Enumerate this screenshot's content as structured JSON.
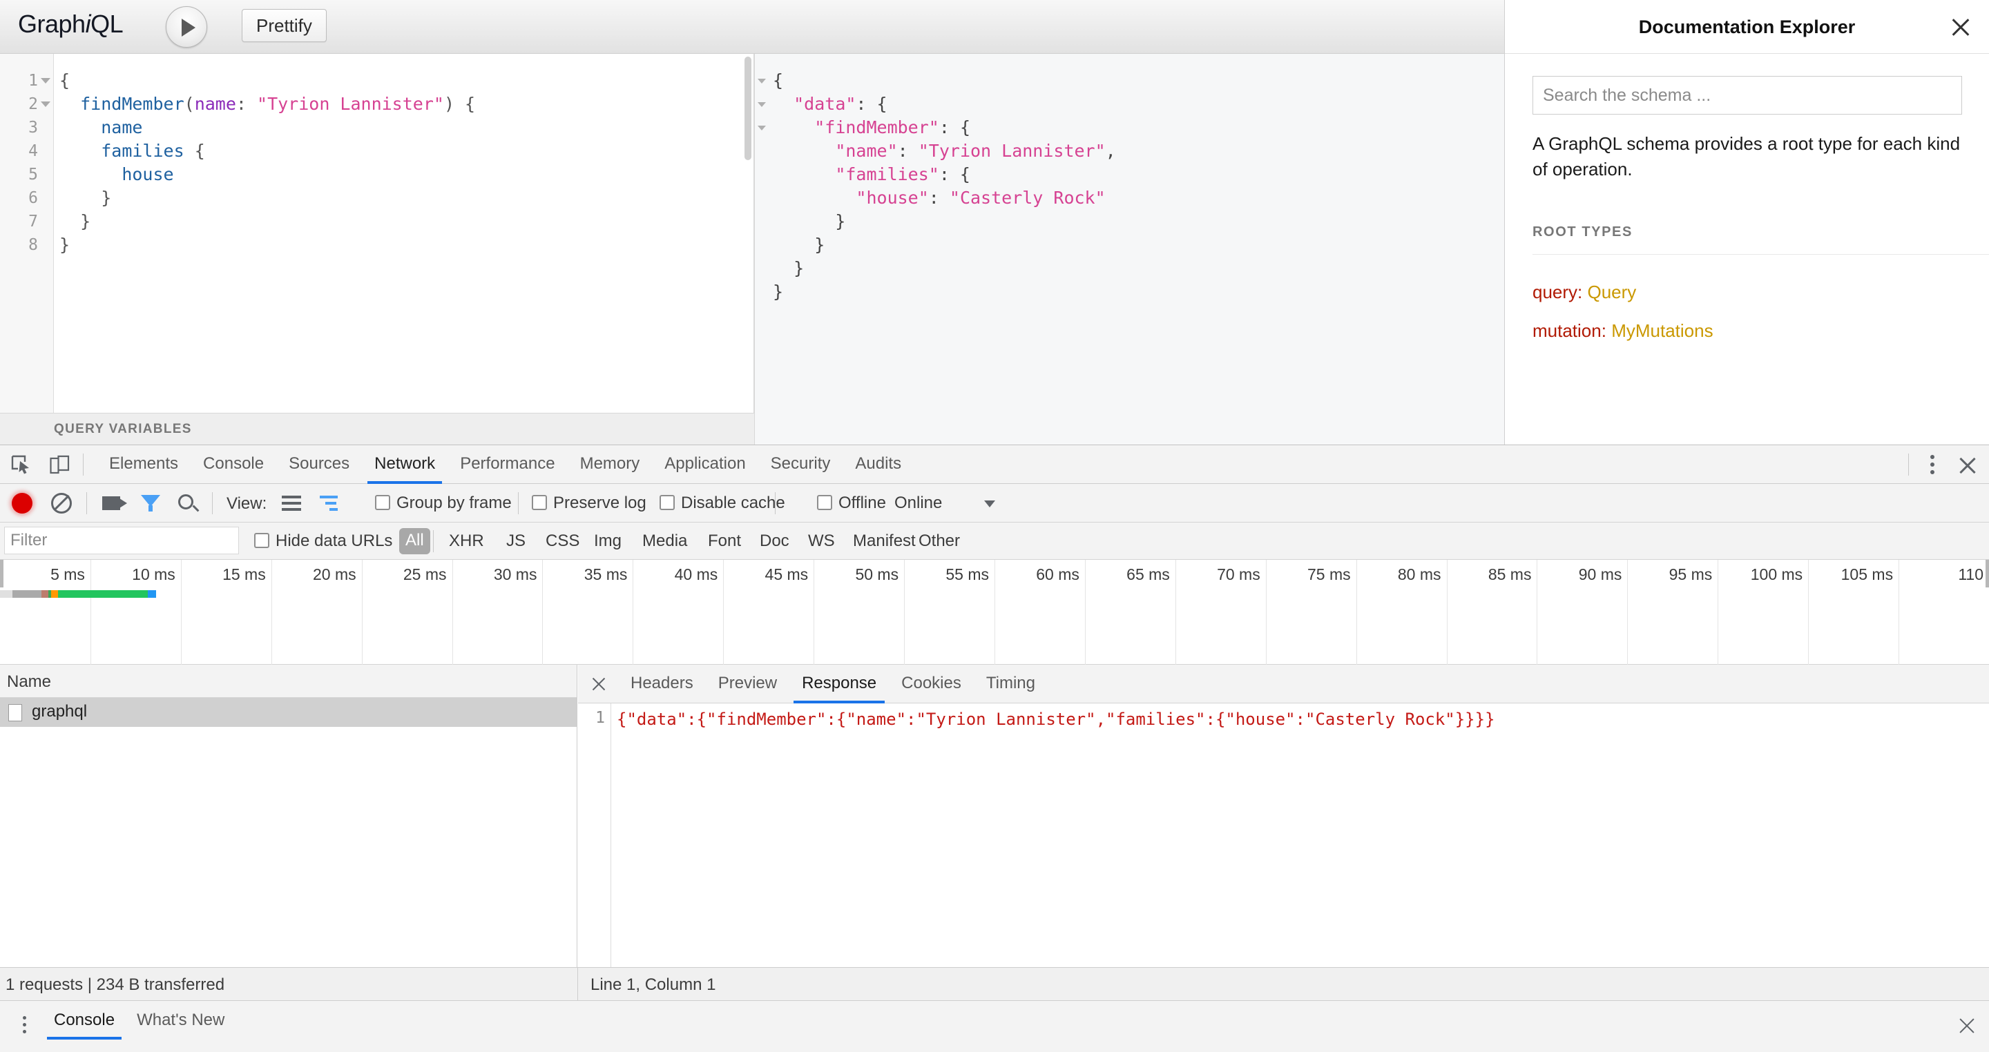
{
  "graphiql": {
    "logo_graph": "Graph",
    "logo_i": "i",
    "logo_ql": "QL",
    "execute_label": "execute-query",
    "prettify_label": "Prettify",
    "query_editor": {
      "lines": [
        {
          "n": "1",
          "fold": true,
          "tokens": [
            {
              "t": "{",
              "c": "tok-punct"
            }
          ]
        },
        {
          "n": "2",
          "fold": true,
          "tokens": [
            {
              "t": "  ",
              "c": "tok-punct"
            },
            {
              "t": "findMember",
              "c": "tok-field"
            },
            {
              "t": "(",
              "c": "tok-punct"
            },
            {
              "t": "name",
              "c": "tok-arg"
            },
            {
              "t": ": ",
              "c": "tok-punct"
            },
            {
              "t": "\"Tyrion Lannister\"",
              "c": "tok-str"
            },
            {
              "t": ") {",
              "c": "tok-punct"
            }
          ]
        },
        {
          "n": "3",
          "fold": false,
          "tokens": [
            {
              "t": "    ",
              "c": "tok-punct"
            },
            {
              "t": "name",
              "c": "tok-field"
            }
          ]
        },
        {
          "n": "4",
          "fold": false,
          "tokens": [
            {
              "t": "    ",
              "c": "tok-punct"
            },
            {
              "t": "families",
              "c": "tok-field"
            },
            {
              "t": " {",
              "c": "tok-punct"
            }
          ]
        },
        {
          "n": "5",
          "fold": false,
          "tokens": [
            {
              "t": "      ",
              "c": "tok-punct"
            },
            {
              "t": "house",
              "c": "tok-field"
            }
          ]
        },
        {
          "n": "6",
          "fold": false,
          "tokens": [
            {
              "t": "    }",
              "c": "tok-punct"
            }
          ]
        },
        {
          "n": "7",
          "fold": false,
          "tokens": [
            {
              "t": "  }",
              "c": "tok-punct"
            }
          ]
        },
        {
          "n": "8",
          "fold": false,
          "tokens": [
            {
              "t": "}",
              "c": "tok-punct"
            }
          ]
        }
      ]
    },
    "variables_label": "QUERY VARIABLES",
    "result_viewer": {
      "lines": [
        {
          "fold": true,
          "tokens": [
            {
              "t": "{",
              "c": "res-punct"
            }
          ]
        },
        {
          "fold": true,
          "tokens": [
            {
              "t": "  ",
              "c": "res-punct"
            },
            {
              "t": "\"data\"",
              "c": "res-key"
            },
            {
              "t": ": {",
              "c": "res-punct"
            }
          ]
        },
        {
          "fold": true,
          "tokens": [
            {
              "t": "    ",
              "c": "res-punct"
            },
            {
              "t": "\"findMember\"",
              "c": "res-key"
            },
            {
              "t": ": {",
              "c": "res-punct"
            }
          ]
        },
        {
          "fold": false,
          "tokens": [
            {
              "t": "      ",
              "c": "res-punct"
            },
            {
              "t": "\"name\"",
              "c": "res-key"
            },
            {
              "t": ": ",
              "c": "res-punct"
            },
            {
              "t": "\"Tyrion Lannister\"",
              "c": "res-str"
            },
            {
              "t": ",",
              "c": "res-punct"
            }
          ]
        },
        {
          "fold": false,
          "tokens": [
            {
              "t": "      ",
              "c": "res-punct"
            },
            {
              "t": "\"families\"",
              "c": "res-key"
            },
            {
              "t": ": {",
              "c": "res-punct"
            }
          ]
        },
        {
          "fold": false,
          "tokens": [
            {
              "t": "        ",
              "c": "res-punct"
            },
            {
              "t": "\"house\"",
              "c": "res-key"
            },
            {
              "t": ": ",
              "c": "res-punct"
            },
            {
              "t": "\"Casterly Rock\"",
              "c": "res-str"
            }
          ]
        },
        {
          "fold": false,
          "tokens": [
            {
              "t": "      }",
              "c": "res-punct"
            }
          ]
        },
        {
          "fold": false,
          "tokens": [
            {
              "t": "    }",
              "c": "res-punct"
            }
          ]
        },
        {
          "fold": false,
          "tokens": [
            {
              "t": "  }",
              "c": "res-punct"
            }
          ]
        },
        {
          "fold": false,
          "tokens": [
            {
              "t": "}",
              "c": "res-punct"
            }
          ]
        }
      ]
    }
  },
  "doc_explorer": {
    "title": "Documentation Explorer",
    "close_label": "close-documentation-explorer",
    "search_placeholder": "Search the schema ...",
    "description": "A GraphQL schema provides a root type for each kind of operation.",
    "root_types_label": "ROOT TYPES",
    "root_types": [
      {
        "field": "query:",
        "type": "Query"
      },
      {
        "field": "mutation:",
        "type": "MyMutations"
      }
    ],
    "field_color": "#b11a04",
    "type_color": "#ca9800"
  },
  "devtools": {
    "tabs": [
      {
        "label": "Elements",
        "active": false
      },
      {
        "label": "Console",
        "active": false
      },
      {
        "label": "Sources",
        "active": false
      },
      {
        "label": "Network",
        "active": true
      },
      {
        "label": "Performance",
        "active": false
      },
      {
        "label": "Memory",
        "active": false
      },
      {
        "label": "Application",
        "active": false
      },
      {
        "label": "Security",
        "active": false
      },
      {
        "label": "Audits",
        "active": false
      }
    ],
    "accent_color": "#1a73e8",
    "network_toolbar": {
      "record_label": "record-network-log",
      "clear_label": "clear-network-log",
      "camera_label": "capture-screenshots",
      "filter_label": "filter",
      "search_label": "search",
      "view_label": "View:",
      "group_by_frame": {
        "label": "Group by frame",
        "checked": false
      },
      "preserve_log": {
        "label": "Preserve log",
        "checked": false
      },
      "disable_cache": {
        "label": "Disable cache",
        "checked": false
      },
      "offline": {
        "label": "Offline",
        "checked": false
      },
      "throttling": "Online"
    },
    "filter_row": {
      "filter_placeholder": "Filter",
      "filter_value": "",
      "hide_data_urls": {
        "label": "Hide data URLs",
        "checked": false
      },
      "types": [
        {
          "label": "All",
          "active": true
        },
        {
          "label": "XHR",
          "active": false
        },
        {
          "label": "JS",
          "active": false
        },
        {
          "label": "CSS",
          "active": false
        },
        {
          "label": "Img",
          "active": false
        },
        {
          "label": "Media",
          "active": false
        },
        {
          "label": "Font",
          "active": false
        },
        {
          "label": "Doc",
          "active": false
        },
        {
          "label": "WS",
          "active": false
        },
        {
          "label": "Manifest",
          "active": false
        },
        {
          "label": "Other",
          "active": false
        }
      ]
    },
    "timeline": {
      "ticks": [
        "5 ms",
        "10 ms",
        "15 ms",
        "20 ms",
        "25 ms",
        "30 ms",
        "35 ms",
        "40 ms",
        "45 ms",
        "50 ms",
        "55 ms",
        "60 ms",
        "65 ms",
        "70 ms",
        "75 ms",
        "80 ms",
        "85 ms",
        "90 ms",
        "95 ms",
        "100 ms",
        "105 ms",
        "110"
      ],
      "overview_segments": [
        {
          "color": "#e0e0e0",
          "width": 18
        },
        {
          "color": "#aaaaaa",
          "width": 42
        },
        {
          "color": "#bd7d6e",
          "width": 10
        },
        {
          "color": "#3aa757",
          "width": 4
        },
        {
          "color": "#ff9800",
          "width": 10
        },
        {
          "color": "#22c55e",
          "width": 130
        },
        {
          "color": "#2196f3",
          "width": 12
        }
      ]
    },
    "requests": {
      "column_name": "Name",
      "rows": [
        {
          "name": "graphql",
          "selected": true
        }
      ]
    },
    "detail": {
      "close_label": "close-request-detail",
      "tabs": [
        {
          "label": "Headers",
          "active": false
        },
        {
          "label": "Preview",
          "active": false
        },
        {
          "label": "Response",
          "active": true
        },
        {
          "label": "Cookies",
          "active": false
        },
        {
          "label": "Timing",
          "active": false
        }
      ],
      "response_line_number": "1",
      "response_text": "{\"data\":{\"findMember\":{\"name\":\"Tyrion Lannister\",\"families\":{\"house\":\"Casterly Rock\"}}}}"
    },
    "status_bar": {
      "requests_summary": "1 requests | 234 B transferred",
      "line_column": "Line 1, Column 1"
    },
    "drawer": {
      "tabs": [
        {
          "label": "Console",
          "active": true
        },
        {
          "label": "What's New",
          "active": false
        }
      ],
      "close_label": "close-drawer"
    }
  }
}
